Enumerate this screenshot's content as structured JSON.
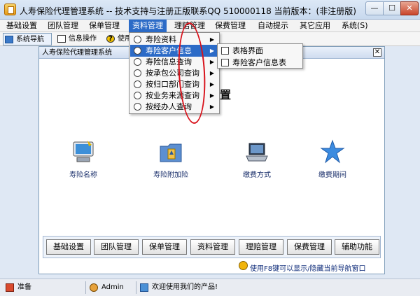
{
  "window": {
    "title": "人寿保险代理管理系统 -- 技术支持与注册正版联系QQ 510000118    当前版本：(非注册版)",
    "min_label": "—",
    "max_label": "☐",
    "close_label": "✕"
  },
  "menubar": {
    "items": [
      "基础设置",
      "团队管理",
      "保单管理",
      "资料管理",
      "理赔管理",
      "保费管理",
      "自动提示",
      "其它应用",
      "系统(S)"
    ],
    "active_index": 3
  },
  "toolbar": {
    "nav_label": "系统导航",
    "info_label": "信息操作",
    "help_label": "使用"
  },
  "inner_window": {
    "title": "人寿保险代理管理系统",
    "close_label": "✕",
    "heading": "置"
  },
  "features": [
    {
      "label": "寿险名称",
      "icon": "computer-icon"
    },
    {
      "label": "寿险附加险",
      "icon": "folder-icon"
    },
    {
      "label": "缴费方式",
      "icon": "laptop-icon"
    },
    {
      "label": "缴费期间",
      "icon": "star-icon"
    }
  ],
  "panel_buttons": [
    "基础设置",
    "团队管理",
    "保单管理",
    "资料管理",
    "理赔管理",
    "保费管理",
    "辅助功能"
  ],
  "hint": "使用F8键可以显示/隐藏当前导航窗口",
  "statusbar": {
    "ready": "准备",
    "user": "Admin",
    "welcome": "欢迎使用我们的产品!"
  },
  "dropdown": {
    "items": [
      "寿险资料",
      "寿险客户信息",
      "寿险信息查询",
      "按承包公司查询",
      "按归口部门查询",
      "按业务来源查询",
      "按经办人查询"
    ],
    "highlight_index": 1,
    "arrow": "▶"
  },
  "submenu": {
    "items": [
      "表格界面",
      "寿险客户信息表"
    ]
  },
  "colors": {
    "accent": "#2c6bc7",
    "annotation": "#d8111a"
  }
}
